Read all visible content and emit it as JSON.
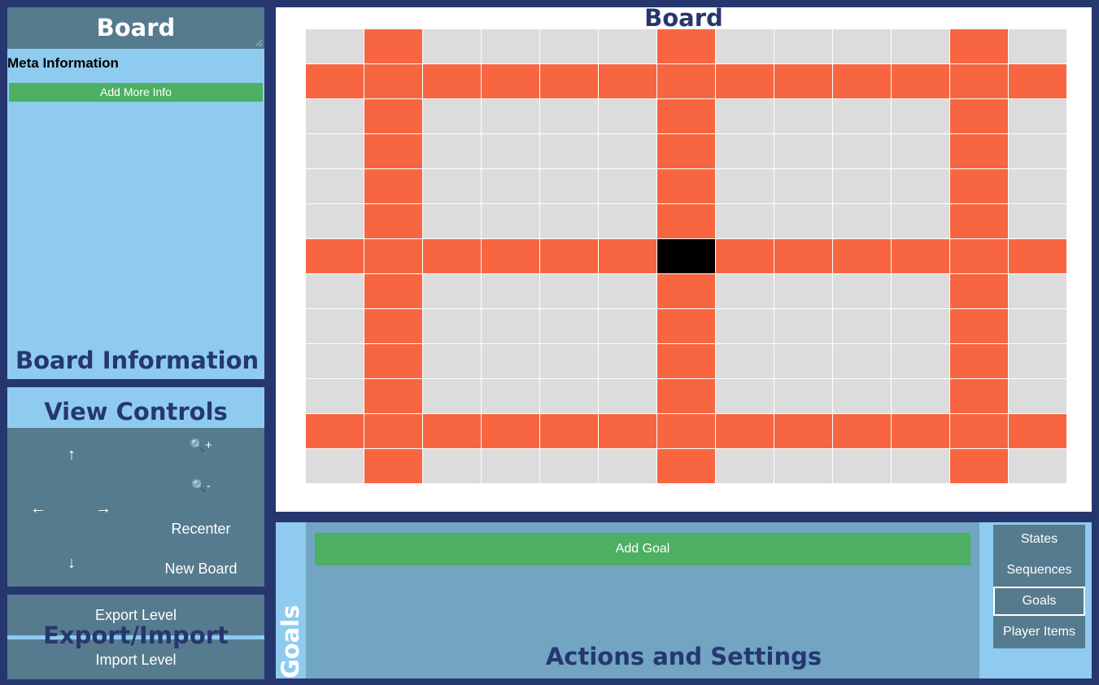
{
  "board_info": {
    "title": "Board",
    "meta_label": "Meta Information",
    "add_info_button": "Add More Info",
    "heading": "Board Information"
  },
  "view_controls": {
    "heading": "View Controls",
    "up": "↑",
    "down": "↓",
    "left": "←",
    "right": "→",
    "zoom_in_glyph": "🔍",
    "zoom_in_sign": "+",
    "zoom_out_glyph": "🔍",
    "zoom_out_sign": "-",
    "recenter": "Recenter",
    "new_board": "New Board"
  },
  "export_import": {
    "export_button": "Export Level",
    "heading": "Export/Import",
    "import_button": "Import Level"
  },
  "board": {
    "heading": "Board",
    "rows": 13,
    "cols": 13,
    "path_rows": [
      1,
      6,
      11
    ],
    "path_cols": [
      1,
      6,
      11
    ],
    "player_cell": [
      6,
      6
    ],
    "colors": {
      "empty": "#dcdcdc",
      "path": "#f76641",
      "player": "#000000"
    }
  },
  "actions": {
    "vertical_label": "Goals",
    "add_goal_button": "Add Goal",
    "heading": "Actions and Settings",
    "tabs": [
      {
        "label": "States",
        "active": false
      },
      {
        "label": "Sequences",
        "active": false
      },
      {
        "label": "Goals",
        "active": true
      },
      {
        "label": "Player Items",
        "active": false
      }
    ]
  },
  "colors": {
    "frame": "#263770",
    "light_panel": "#8ecbef",
    "dark_panel": "#567a8e",
    "button_green": "#4daf62"
  }
}
